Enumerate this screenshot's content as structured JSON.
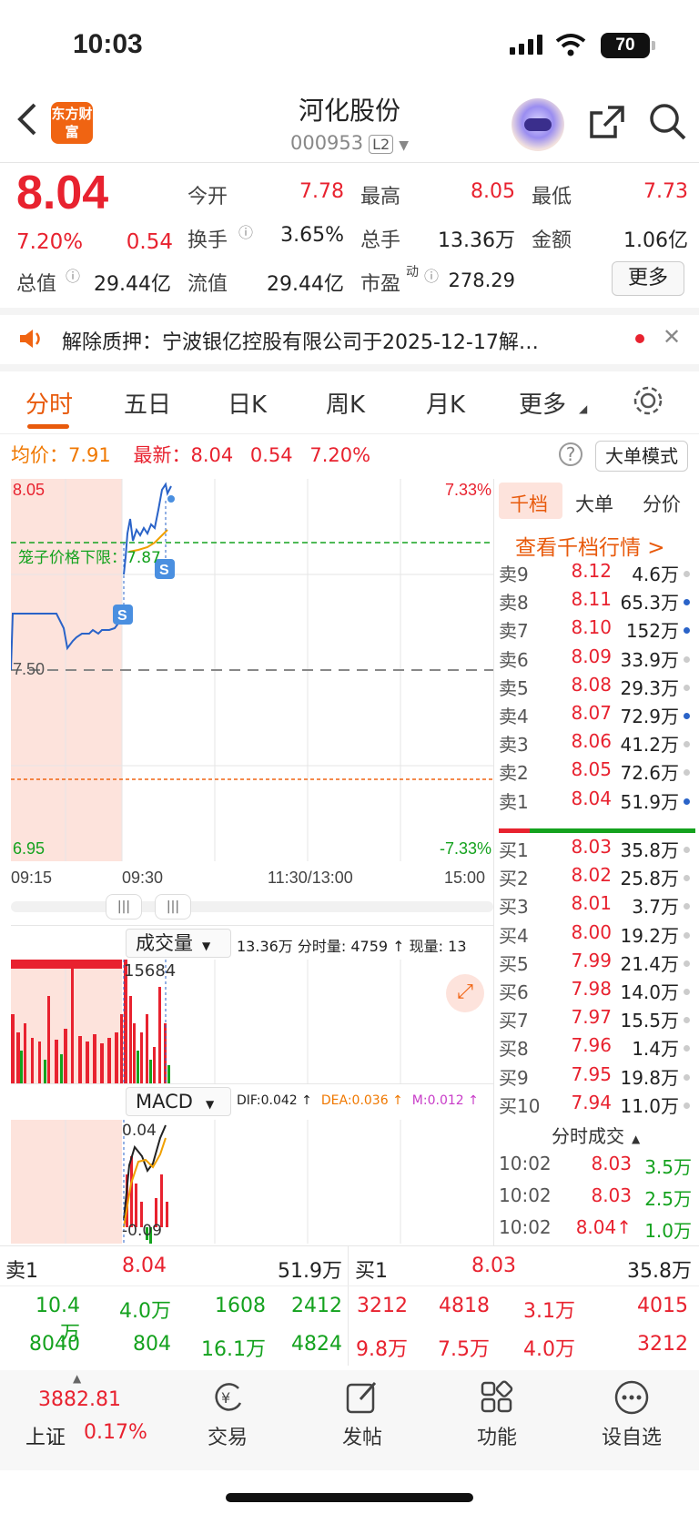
{
  "status": {
    "time": "10:03",
    "battery": "70"
  },
  "header": {
    "title": "河化股份",
    "code": "000953",
    "level": "L2",
    "logo_text": "东方财富"
  },
  "quote": {
    "price": "8.04",
    "pct": "7.20%",
    "change": "0.54",
    "fields": [
      {
        "label": "今开",
        "value": "7.78"
      },
      {
        "label": "最高",
        "value": "8.05"
      },
      {
        "label": "最低",
        "value": "7.73"
      },
      {
        "label": "换手",
        "value": "3.65%"
      },
      {
        "label": "总手",
        "value": "13.36万"
      },
      {
        "label": "金额",
        "value": "1.06亿"
      },
      {
        "label": "总值",
        "value": "29.44亿"
      },
      {
        "label": "流值",
        "value": "29.44亿"
      },
      {
        "label": "市盈",
        "sup": "动",
        "value": "278.29"
      }
    ],
    "more": "更多"
  },
  "notice": {
    "text": "解除质押：宁波银亿控股有限公司于2025-12-17解…"
  },
  "tabs": [
    "分时",
    "五日",
    "日K",
    "周K",
    "月K",
    "更多"
  ],
  "infobar": {
    "avg_label": "均价：",
    "avg": "7.91",
    "latest_label": "最新：",
    "latest": "8.04",
    "chg": "0.54",
    "pct": "7.20%",
    "mode": "大单模式"
  },
  "chart": {
    "hi": "8.05",
    "lo": "6.95",
    "mid": "7.50",
    "hi_pct": "7.33%",
    "lo_pct": "-7.33%",
    "cage": "笼子价格下限：7.87",
    "times": [
      "09:15",
      "09:30",
      "11:30/13:00",
      "15:00"
    ],
    "vol_label": "成交量",
    "vol_info": "13.36万 分时量: 4759 ↑ 现量: 13",
    "vol_peak": "15684",
    "macd_label": "MACD",
    "dif": "DIF:0.042 ↑",
    "dea": "DEA:0.036 ↑",
    "m": "M:0.012 ↑",
    "macd_hi": "0.04",
    "macd_lo": "-0.09"
  },
  "side": {
    "tabs": [
      "千档",
      "大单",
      "分价"
    ],
    "link": "查看千档行情 >",
    "sells": [
      [
        "卖9",
        "8.12",
        "4.6万"
      ],
      [
        "卖8",
        "8.11",
        "65.3万"
      ],
      [
        "卖7",
        "8.10",
        "152万"
      ],
      [
        "卖6",
        "8.09",
        "33.9万"
      ],
      [
        "卖5",
        "8.08",
        "29.3万"
      ],
      [
        "卖4",
        "8.07",
        "72.9万"
      ],
      [
        "卖3",
        "8.06",
        "41.2万"
      ],
      [
        "卖2",
        "8.05",
        "72.6万"
      ],
      [
        "卖1",
        "8.04",
        "51.9万"
      ]
    ],
    "buys": [
      [
        "买1",
        "8.03",
        "35.8万"
      ],
      [
        "买2",
        "8.02",
        "25.8万"
      ],
      [
        "买3",
        "8.01",
        "3.7万"
      ],
      [
        "买4",
        "8.00",
        "19.2万"
      ],
      [
        "买5",
        "7.99",
        "21.4万"
      ],
      [
        "买6",
        "7.98",
        "14.0万"
      ],
      [
        "买7",
        "7.97",
        "15.5万"
      ],
      [
        "买8",
        "7.96",
        "1.4万"
      ],
      [
        "买9",
        "7.95",
        "19.8万"
      ],
      [
        "买10",
        "7.94",
        "11.0万"
      ]
    ],
    "trades_label": "分时成交",
    "trades": [
      [
        "10:02",
        "8.03",
        "3.5万"
      ],
      [
        "10:02",
        "8.03",
        "2.5万"
      ],
      [
        "10:02",
        "8.04↑",
        "1.0万"
      ]
    ]
  },
  "bottom": {
    "sell_label": "卖1",
    "sell_price": "8.04",
    "sell_vol": "51.9万",
    "buy_label": "买1",
    "buy_price": "8.03",
    "buy_vol": "35.8万",
    "left_rows": [
      [
        "10.4万",
        "4.0万",
        "1608",
        "2412"
      ],
      [
        "8040",
        "804",
        "16.1万",
        "4824"
      ]
    ],
    "right_rows": [
      [
        "3212",
        "4818",
        "3.1万",
        "4015"
      ],
      [
        "9.8万",
        "7.5万",
        "4.0万",
        "3212"
      ]
    ]
  },
  "nav": {
    "index_val": "3882.81",
    "index_name": "上证",
    "index_pct": "0.17%",
    "items": [
      "交易",
      "发帖",
      "功能",
      "设自选"
    ]
  }
}
